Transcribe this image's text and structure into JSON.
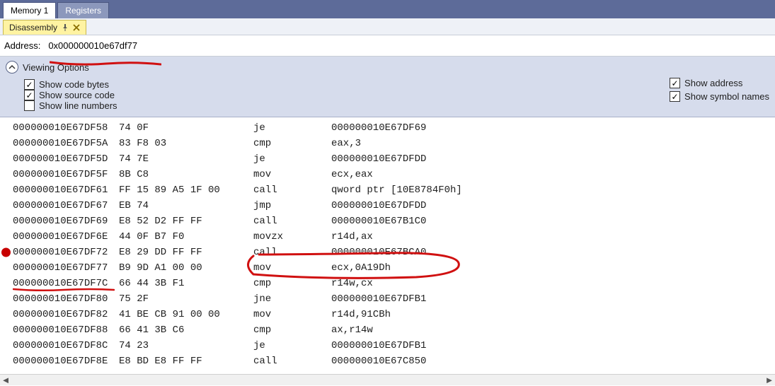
{
  "tabs": {
    "memory": "Memory 1",
    "registers": "Registers"
  },
  "subtab": {
    "title": "Disassembly"
  },
  "address": {
    "label": "Address:",
    "value": "0x000000010e67df77"
  },
  "options": {
    "header": "Viewing Options",
    "left": [
      {
        "label": "Show code bytes",
        "checked": true
      },
      {
        "label": "Show source code",
        "checked": true
      },
      {
        "label": "Show line numbers",
        "checked": false
      }
    ],
    "right": [
      {
        "label": "Show address",
        "checked": true
      },
      {
        "label": "Show symbol names",
        "checked": true
      }
    ]
  },
  "disasm": [
    {
      "addr": "000000010E67DF58",
      "bytes": "74 0F",
      "mnem": "je",
      "ops": "000000010E67DF69",
      "bp": false
    },
    {
      "addr": "000000010E67DF5A",
      "bytes": "83 F8 03",
      "mnem": "cmp",
      "ops": "eax,3",
      "bp": false
    },
    {
      "addr": "000000010E67DF5D",
      "bytes": "74 7E",
      "mnem": "je",
      "ops": "000000010E67DFDD",
      "bp": false
    },
    {
      "addr": "000000010E67DF5F",
      "bytes": "8B C8",
      "mnem": "mov",
      "ops": "ecx,eax",
      "bp": false
    },
    {
      "addr": "000000010E67DF61",
      "bytes": "FF 15 89 A5 1F 00",
      "mnem": "call",
      "ops": "qword ptr [10E8784F0h]",
      "bp": false
    },
    {
      "addr": "000000010E67DF67",
      "bytes": "EB 74",
      "mnem": "jmp",
      "ops": "000000010E67DFDD",
      "bp": false
    },
    {
      "addr": "000000010E67DF69",
      "bytes": "E8 52 D2 FF FF",
      "mnem": "call",
      "ops": "000000010E67B1C0",
      "bp": false
    },
    {
      "addr": "000000010E67DF6E",
      "bytes": "44 0F B7 F0",
      "mnem": "movzx",
      "ops": "r14d,ax",
      "bp": false
    },
    {
      "addr": "000000010E67DF72",
      "bytes": "E8 29 DD FF FF",
      "mnem": "call",
      "ops": "000000010E67BCA0",
      "bp": true
    },
    {
      "addr": "000000010E67DF77",
      "bytes": "B9 9D A1 00 00",
      "mnem": "mov",
      "ops": "ecx,0A19Dh",
      "bp": false
    },
    {
      "addr": "000000010E67DF7C",
      "bytes": "66 44 3B F1",
      "mnem": "cmp",
      "ops": "r14w,cx",
      "bp": false
    },
    {
      "addr": "000000010E67DF80",
      "bytes": "75 2F",
      "mnem": "jne",
      "ops": "000000010E67DFB1",
      "bp": false
    },
    {
      "addr": "000000010E67DF82",
      "bytes": "41 BE CB 91 00 00",
      "mnem": "mov",
      "ops": "r14d,91CBh",
      "bp": false
    },
    {
      "addr": "000000010E67DF88",
      "bytes": "66 41 3B C6",
      "mnem": "cmp",
      "ops": "ax,r14w",
      "bp": false
    },
    {
      "addr": "000000010E67DF8C",
      "bytes": "74 23",
      "mnem": "je",
      "ops": "000000010E67DFB1",
      "bp": false
    },
    {
      "addr": "000000010E67DF8E",
      "bytes": "E8 BD E8 FF FF",
      "mnem": "call",
      "ops": "000000010E67C850",
      "bp": false
    }
  ]
}
